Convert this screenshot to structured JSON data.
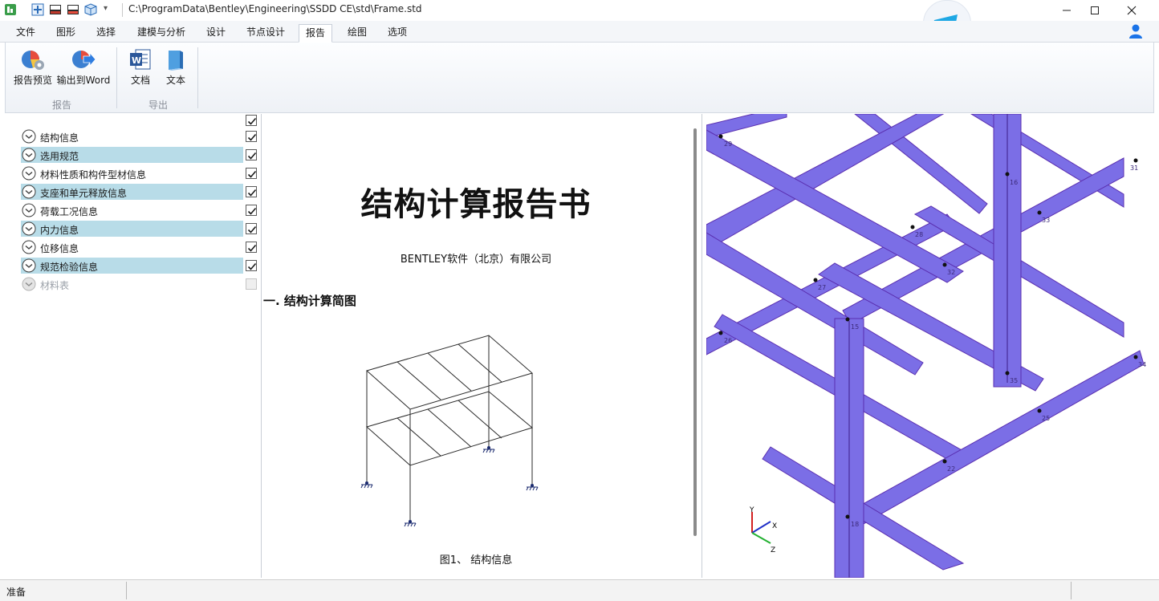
{
  "window": {
    "title": "C:\\ProgramData\\Bentley\\Engineering\\SSDD CE\\std\\Frame.std",
    "qa_dropdown": "▾",
    "minimize_glyph": "—",
    "maximize_glyph": "☐",
    "close_glyph": "✕"
  },
  "menu": {
    "tabs": [
      {
        "label": "文件"
      },
      {
        "label": "图形"
      },
      {
        "label": "选择"
      },
      {
        "label": "建模与分析"
      },
      {
        "label": "设计"
      },
      {
        "label": "节点设计"
      },
      {
        "label": "报告"
      },
      {
        "label": "绘图"
      },
      {
        "label": "选项"
      }
    ],
    "active_tab": "报告"
  },
  "ribbon": {
    "groups": [
      {
        "label": "报告",
        "buttons": [
          {
            "label": "报告预览",
            "icon": "report-preview-icon"
          },
          {
            "label": "输出到Word",
            "icon": "export-word-icon"
          }
        ]
      },
      {
        "label": "导出",
        "buttons": [
          {
            "label": "文档",
            "icon": "word-document-icon"
          },
          {
            "label": "文本",
            "icon": "text-document-icon"
          }
        ]
      }
    ]
  },
  "tree": {
    "items": [
      {
        "label": "结构信息",
        "checked": true,
        "highlighted": false,
        "enabled": true
      },
      {
        "label": "选用规范",
        "checked": true,
        "highlighted": true,
        "enabled": true
      },
      {
        "label": "材料性质和构件型材信息",
        "checked": true,
        "highlighted": false,
        "enabled": true
      },
      {
        "label": "支座和单元释放信息",
        "checked": true,
        "highlighted": true,
        "enabled": true
      },
      {
        "label": "荷载工况信息",
        "checked": true,
        "highlighted": false,
        "enabled": true
      },
      {
        "label": "内力信息",
        "checked": true,
        "highlighted": true,
        "enabled": true
      },
      {
        "label": "位移信息",
        "checked": true,
        "highlighted": false,
        "enabled": true
      },
      {
        "label": "规范检验信息",
        "checked": true,
        "highlighted": true,
        "enabled": true
      },
      {
        "label": "材料表",
        "checked": false,
        "highlighted": false,
        "enabled": false
      }
    ],
    "select_all_checked": true
  },
  "document": {
    "title": "结构计算报告书",
    "company": "BENTLEY软件（北京）有限公司",
    "section_heading": "一. 结构计算简图",
    "figure_caption": "图1、  结构信息"
  },
  "view3d": {
    "member_color": "#7b6ee6",
    "member_edge_color": "#5a2fb0",
    "node_labels": [
      "29",
      "31",
      "16",
      "33",
      "28",
      "32",
      "27",
      "15",
      "26",
      "35",
      "34",
      "25",
      "22",
      "18"
    ],
    "axis_labels": {
      "x": "X",
      "y": "Y",
      "z": "Z"
    }
  },
  "status": {
    "text": "准备"
  },
  "colors": {
    "highlight": "#b8dce8",
    "accent_blue": "#1a73e8"
  }
}
